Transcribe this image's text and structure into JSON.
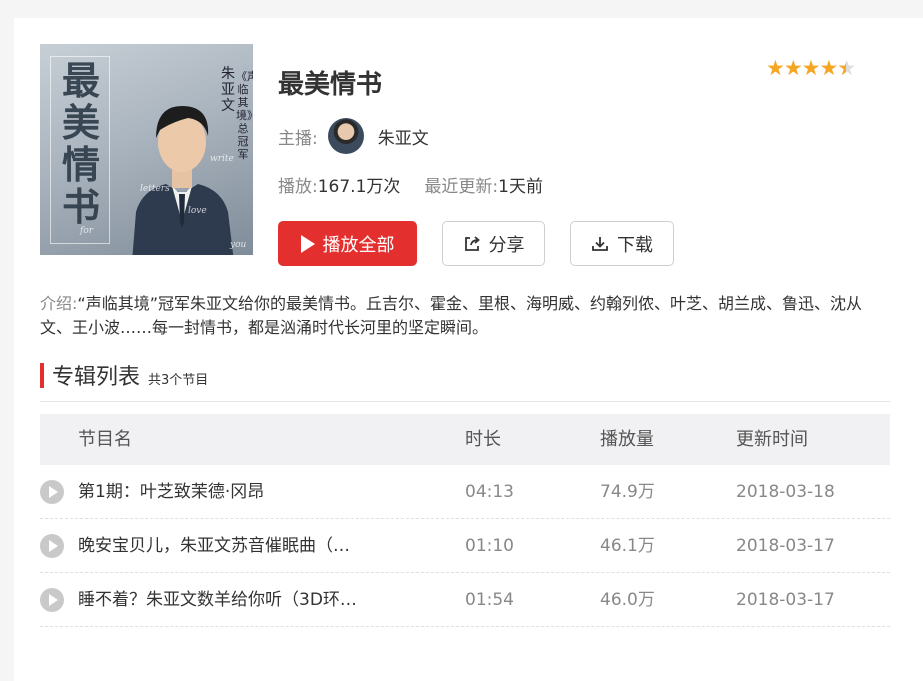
{
  "album": {
    "title": "最美情书",
    "cover": {
      "title_text": "最美情书",
      "host_text": "朱亚文",
      "subtitle_text": "《声临其境》总冠军",
      "deco_words": [
        "letters",
        "write",
        "love",
        "for",
        "you"
      ]
    },
    "rating": 4.5,
    "host_label": "主播:",
    "host_name": "朱亚文",
    "plays_label": "播放:",
    "plays_value": "167.1万次",
    "updated_label": "最近更新:",
    "updated_value": "1天前"
  },
  "actions": {
    "play_all": "播放全部",
    "share": "分享",
    "download": "下载"
  },
  "intro": {
    "label": "介绍:",
    "text": "“声临其境”冠军朱亚文给你的最美情书。丘吉尔、霍金、里根、海明威、约翰列侬、叶芝、胡兰成、鲁迅、沈从文、王小波……每一封情书，都是汹涌时代长河里的坚定瞬间。"
  },
  "section": {
    "title": "专辑列表",
    "count": "共3个节目"
  },
  "table": {
    "headers": {
      "name": "节目名",
      "duration": "时长",
      "plays": "播放量",
      "updated": "更新时间"
    },
    "rows": [
      {
        "name": "第1期：叶芝致茉德·冈昂",
        "duration": "04:13",
        "plays": "74.9万",
        "updated": "2018-03-18"
      },
      {
        "name": "晚安宝贝儿，朱亚文苏音催眠曲（…",
        "duration": "01:10",
        "plays": "46.1万",
        "updated": "2018-03-17"
      },
      {
        "name": "睡不着？朱亚文数羊给你听（3D环…",
        "duration": "01:54",
        "plays": "46.0万",
        "updated": "2018-03-17"
      }
    ]
  },
  "colors": {
    "accent": "#e3302f",
    "star": "#f5a623"
  },
  "icons": {
    "play_all": "play-icon",
    "share": "share-icon",
    "download": "download-icon",
    "row_play": "play-circle-icon",
    "rating": "star-icon"
  }
}
